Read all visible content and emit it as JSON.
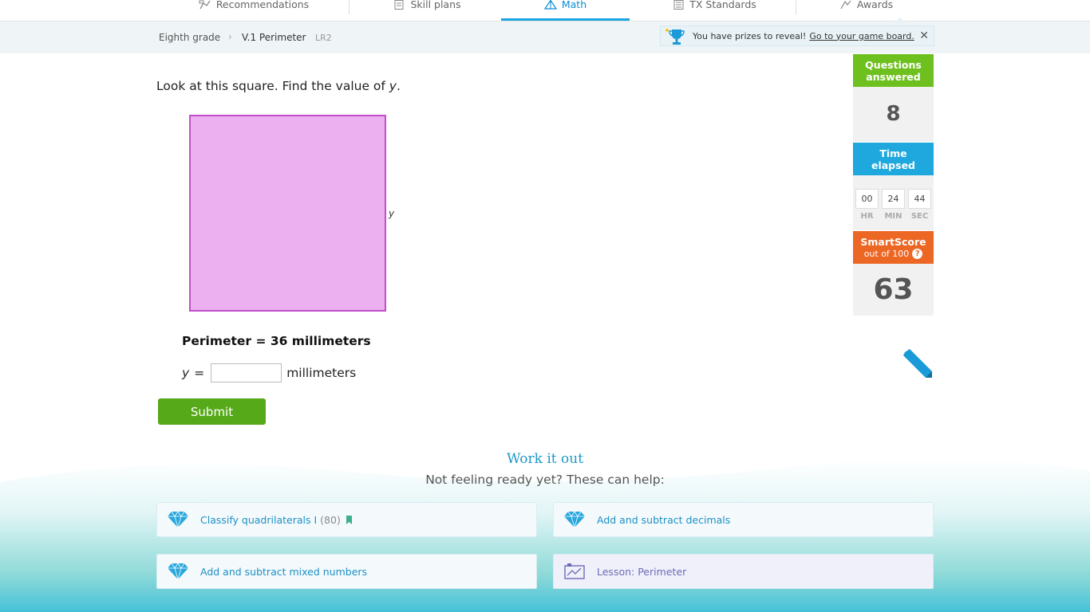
{
  "nav": {
    "tabs": [
      {
        "label": "Recommendations",
        "icon": "recommendations-icon"
      },
      {
        "label": "Skill plans",
        "icon": "skill-plans-icon"
      },
      {
        "label": "Math",
        "icon": "math-icon",
        "active": true
      },
      {
        "label": "TX Standards",
        "icon": "standards-icon"
      },
      {
        "label": "Awards",
        "icon": "awards-icon"
      }
    ]
  },
  "breadcrumb": {
    "grade": "Eighth grade",
    "skill": "V.1 Perimeter",
    "code": "LR2"
  },
  "prize_banner": {
    "text": "You have prizes to reveal!",
    "link": "Go to your game board."
  },
  "question": {
    "prompt_start": "Look at this square. Find the value of ",
    "prompt_var": "y",
    "prompt_end": ".",
    "side_label": "y",
    "perimeter_text": "Perimeter = 36 millimeters",
    "answer_var": "y",
    "answer_eq": "=",
    "answer_value": "",
    "answer_unit": "millimeters",
    "submit_label": "Submit"
  },
  "stats": {
    "questions_label_1": "Questions",
    "questions_label_2": "answered",
    "questions_value": "8",
    "time_label_1": "Time",
    "time_label_2": "elapsed",
    "time": {
      "hr": "00",
      "min": "24",
      "sec": "44"
    },
    "time_units": {
      "hr": "HR",
      "min": "MIN",
      "sec": "SEC"
    },
    "smartscore_label": "SmartScore",
    "smartscore_sub": "out of 100",
    "smartscore_help": "?",
    "smartscore_value": "63"
  },
  "work_it_out": {
    "title": "Work it out",
    "subtitle": "Not feeling ready yet? These can help:",
    "cards": [
      {
        "label": "Classify quadrilaterals I",
        "count": "(80)",
        "icon": "diamond-icon",
        "bookmarked": true
      },
      {
        "label": "Add and subtract decimals",
        "icon": "diamond-icon"
      },
      {
        "label": "Add and subtract mixed numbers",
        "icon": "diamond-icon"
      },
      {
        "label": "Lesson: Perimeter",
        "icon": "lesson-icon"
      }
    ]
  },
  "colors": {
    "accent": "#1aa6e0",
    "square_fill": "#ecb0f0",
    "square_stroke": "#c24fc9",
    "submit": "#56a918",
    "questions": "#6ec01e",
    "time": "#1fa8dd",
    "smartscore": "#ec6624"
  }
}
